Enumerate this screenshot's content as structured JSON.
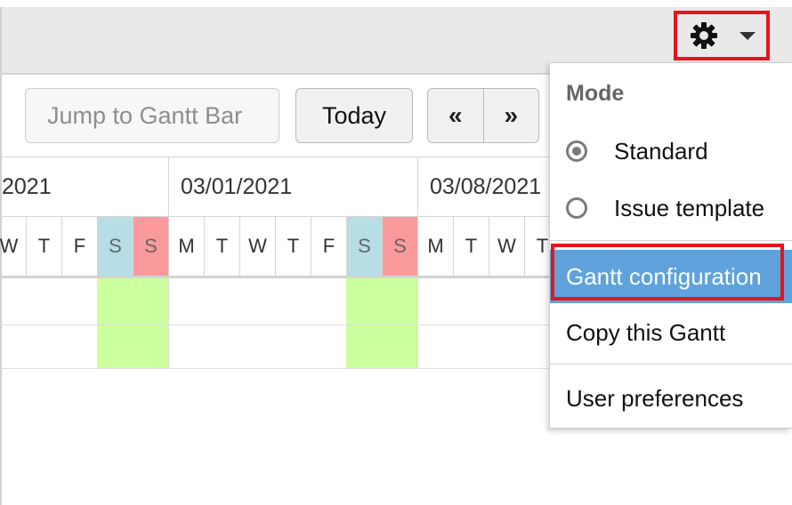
{
  "header": {
    "settings_icon": "gear-icon",
    "dropdown_icon": "caret-down-icon",
    "highlight_color": "#e8141b"
  },
  "toolbar": {
    "jump_placeholder": "Jump to Gantt Bar",
    "today_label": "Today",
    "prev_label": "«",
    "next_label": "»"
  },
  "timeline": {
    "weeks": [
      "2021",
      "03/01/2021",
      "03/08/2021"
    ],
    "days": [
      "W",
      "T",
      "F",
      "S",
      "S",
      "M",
      "T",
      "W",
      "T",
      "F",
      "S",
      "S",
      "M",
      "T",
      "W",
      "T"
    ],
    "colors": {
      "saturday": "#b7dde5",
      "sunday": "#fb9a9c",
      "weekend_cell": "#ccff9d"
    }
  },
  "menu": {
    "mode_heading": "Mode",
    "modes": [
      {
        "label": "Standard",
        "checked": true
      },
      {
        "label": "Issue template",
        "checked": false
      }
    ],
    "items": [
      {
        "label": "Gantt configuration",
        "active": true
      },
      {
        "label": "Copy this Gantt",
        "active": false
      },
      {
        "label": "User preferences",
        "active": false
      }
    ],
    "active_color": "#5fa2dc"
  }
}
